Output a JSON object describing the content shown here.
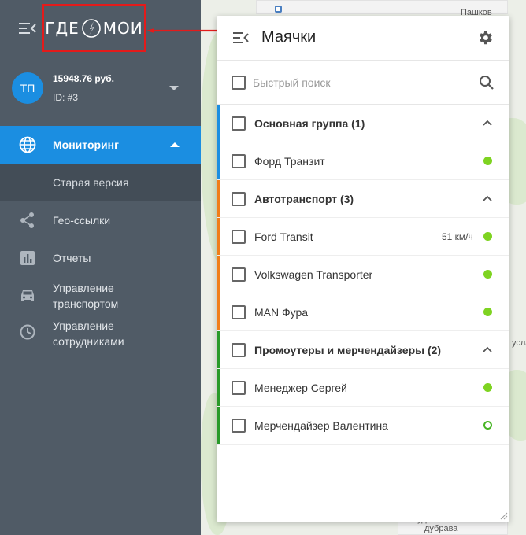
{
  "sidebar": {
    "logo_text_left": "ГДЕ",
    "logo_text_right": "МОИ",
    "account": {
      "avatar_initials": "ТП",
      "balance": "15948.76 руб.",
      "id": "ID: #3"
    },
    "nav": {
      "monitoring": "Мониторинг",
      "old_version": "Старая версия",
      "geo_links": "Гео-ссылки",
      "reports": "Отчеты",
      "transport_line1": "Управление",
      "transport_line2": "транспортом",
      "staff_line1": "Управление",
      "staff_line2": "сотрудниками"
    }
  },
  "panel": {
    "title": "Маячки",
    "search_placeholder": "Быстрый поиск",
    "groups": [
      {
        "name": "Основная группа (1)",
        "color": "#1b8ee1",
        "items": [
          {
            "name": "Форд Транзит",
            "speed": "",
            "status": "online"
          }
        ]
      },
      {
        "name": "Автотранспорт (3)",
        "color": "#f07d1a",
        "items": [
          {
            "name": "Ford Transit",
            "speed": "51 км/ч",
            "status": "online"
          },
          {
            "name": "Volkswagen Transporter",
            "speed": "",
            "status": "online"
          },
          {
            "name": "MAN Фура",
            "speed": "",
            "status": "online"
          }
        ]
      },
      {
        "name": "Промоутеры и мерчендайзеры (2)",
        "color": "#2a9a2a",
        "items": [
          {
            "name": "Менеджер Сергей",
            "speed": "",
            "status": "online"
          },
          {
            "name": "Мерчендайзер Валентина",
            "speed": "",
            "status": "hollow"
          }
        ]
      }
    ]
  },
  "map": {
    "labels": {
      "top_right": "Пашков",
      "right_mid": "усла",
      "bottom_1": "Студеновская",
      "bottom_2": "дубрава"
    }
  },
  "colors": {
    "sidebar_bg": "#505b66",
    "accent_blue": "#1b8ee1",
    "highlight_red": "#e31b1b",
    "online_green": "#7ed321"
  },
  "icons": {
    "sidebar_menu": "menu-collapse-icon",
    "logo": "compass-logo-icon",
    "monitoring": "globe-icon",
    "geo_links": "share-icon",
    "reports": "bar-chart-icon",
    "transport": "car-icon",
    "staff": "clock-icon",
    "panel_menu": "menu-collapse-icon",
    "settings": "gear-icon",
    "search": "search-icon"
  }
}
